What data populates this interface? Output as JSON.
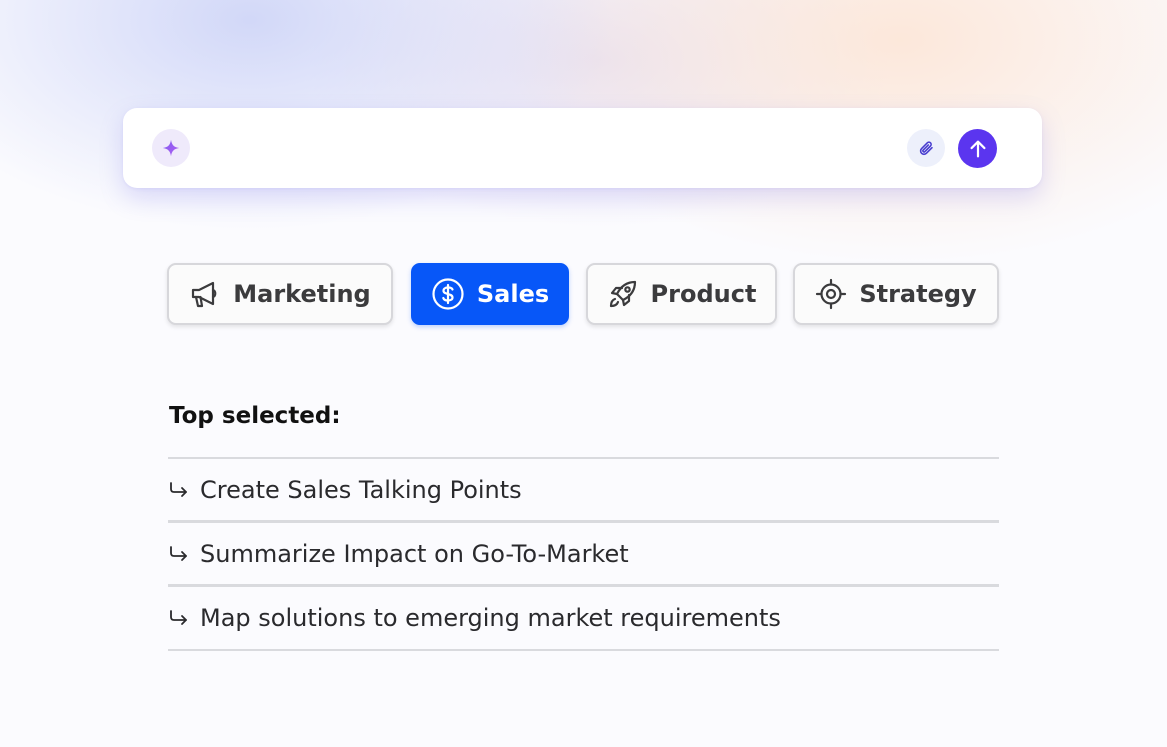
{
  "prompt": {
    "placeholder": "",
    "value": "",
    "sparkle_icon": "sparkle-icon",
    "attach_icon": "paperclip-icon",
    "send_icon": "arrow-up-icon",
    "accent_color": "#5b35ef"
  },
  "categories": [
    {
      "label": "Marketing",
      "icon": "megaphone-icon",
      "active": false
    },
    {
      "label": "Sales",
      "icon": "dollar-circle-icon",
      "active": true
    },
    {
      "label": "Product",
      "icon": "rocket-icon",
      "active": false
    },
    {
      "label": "Strategy",
      "icon": "target-icon",
      "active": false
    }
  ],
  "active_color": "#0757f8",
  "top_selected": {
    "heading": "Top selected:",
    "items": [
      {
        "label": "Create Sales Talking Points",
        "icon": "return-arrow-icon"
      },
      {
        "label": "Summarize Impact on Go-To-Market",
        "icon": "return-arrow-icon"
      },
      {
        "label": "Map solutions to emerging market requirements",
        "icon": "return-arrow-icon"
      }
    ]
  }
}
